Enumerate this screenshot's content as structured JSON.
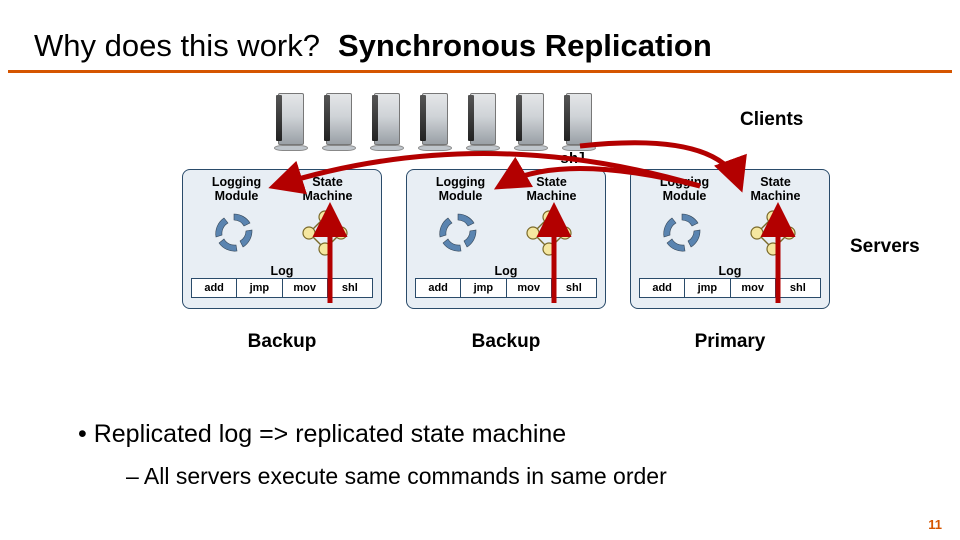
{
  "title": {
    "left": "Why does this work?",
    "right": "Synchronous Replication"
  },
  "labels": {
    "clients": "Clients",
    "servers": "Servers",
    "command": "shl"
  },
  "server_template": {
    "logging": "Logging\nModule",
    "state": "State\nMachine",
    "log_label": "Log",
    "ops": [
      "add",
      "jmp",
      "mov",
      "shl"
    ]
  },
  "servers": [
    {
      "role": "Backup"
    },
    {
      "role": "Backup"
    },
    {
      "role": "Primary"
    }
  ],
  "bullets": {
    "main": "Replicated log => replicated state machine",
    "sub": "All servers execute same commands in same order"
  },
  "page_number": "11",
  "colors": {
    "accent": "#d55500",
    "panel_border": "#2a4b6a",
    "arrow": "#b30000"
  }
}
